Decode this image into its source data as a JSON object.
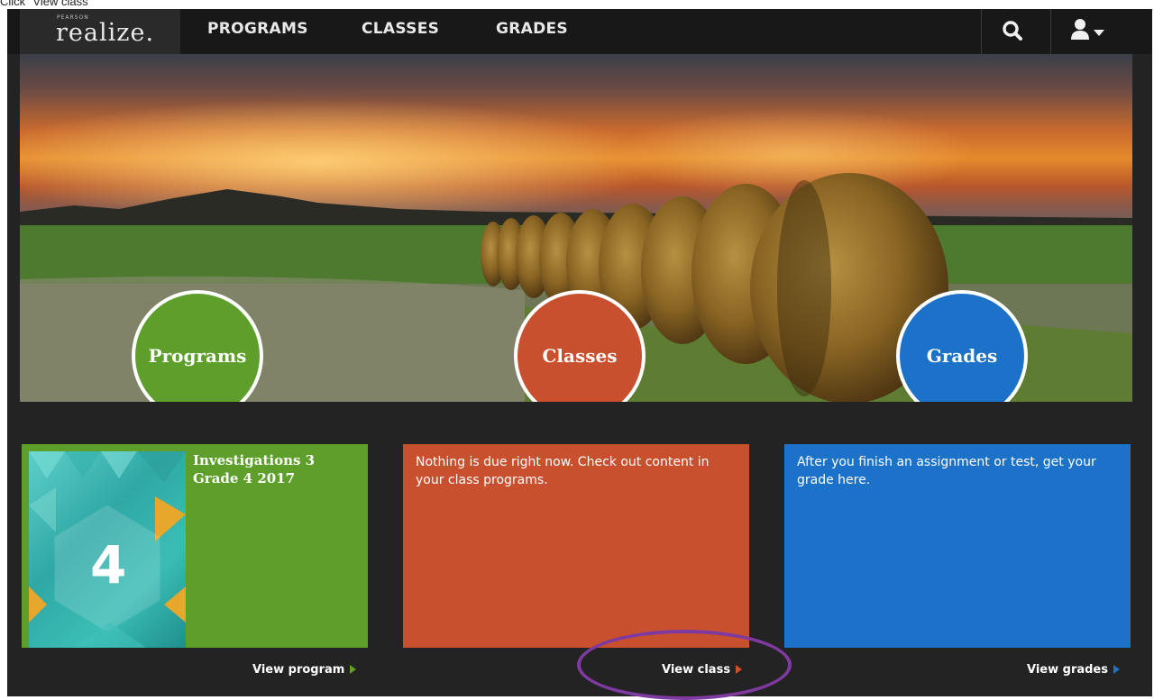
{
  "instruction": "Click \"View class\"",
  "nav": {
    "logo_pearson": "PEARSON",
    "logo_text": "realize.",
    "items": [
      {
        "label": "PROGRAMS"
      },
      {
        "label": "CLASSES"
      },
      {
        "label": "GRADES"
      }
    ],
    "search_icon": "search-icon",
    "user_icon": "user-icon",
    "user_menu_icon": "caret-down-icon"
  },
  "hero": {
    "circles": [
      {
        "label": "Programs",
        "color": "#5e9f2c"
      },
      {
        "label": "Classes",
        "color": "#c8502f"
      },
      {
        "label": "Grades",
        "color": "#1b72c8"
      }
    ]
  },
  "cards": {
    "programs": {
      "title": "Investigations 3 Grade 4 2017",
      "cover_digit": "4",
      "color": "#5e9f2c",
      "link": "View program"
    },
    "classes": {
      "text": "Nothing is due right now. Check out content in your class programs.",
      "color": "#c8502f",
      "link": "View class"
    },
    "grades": {
      "text": "After you finish an assignment or test, get your grade here.",
      "color": "#1b72c8",
      "link": "View grades"
    }
  },
  "colors": {
    "nav_bg": "#181818",
    "page_bg": "#232323",
    "highlight": "#7e3a9e"
  }
}
